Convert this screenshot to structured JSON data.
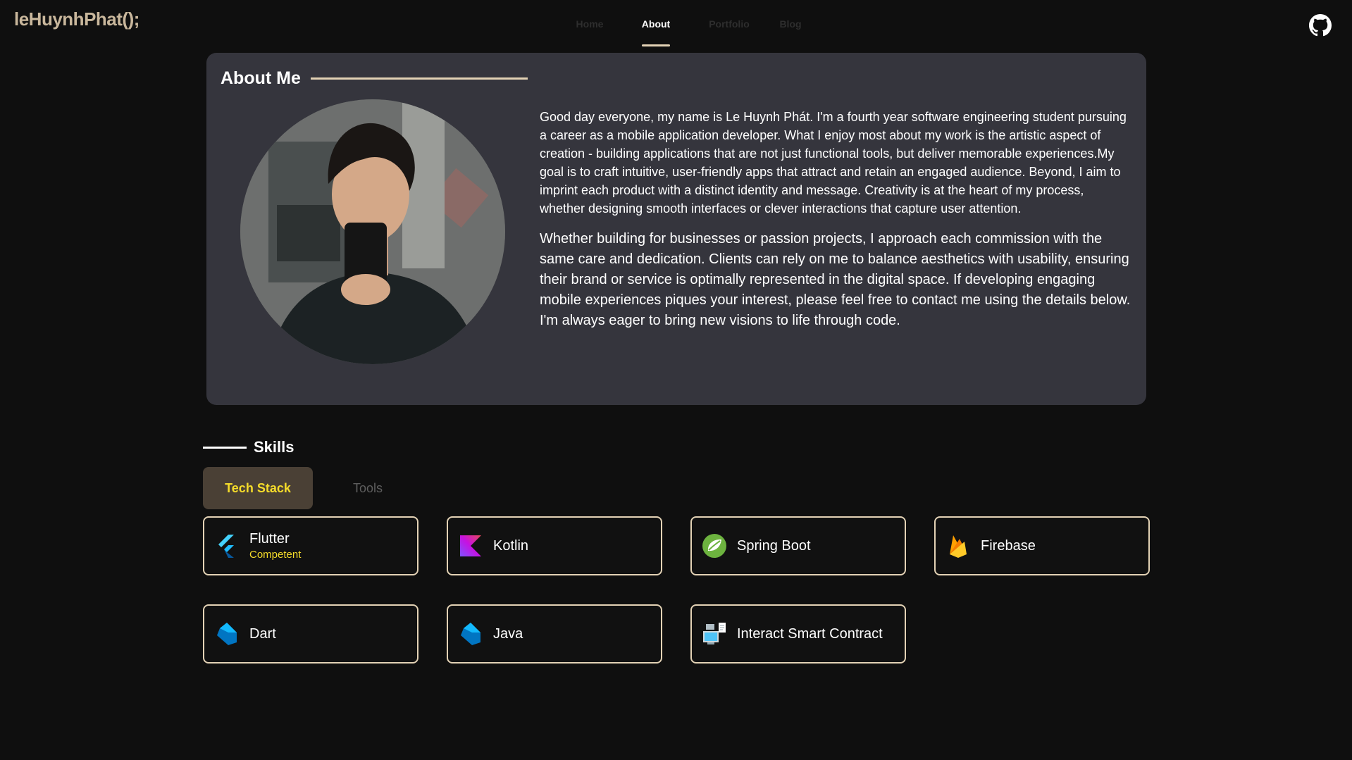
{
  "header": {
    "logo": "leHuynhPhat();",
    "nav": [
      "Home",
      "About",
      "Portfolio",
      "Blog"
    ],
    "active_nav": "About",
    "github_icon": "github-icon"
  },
  "about": {
    "title": "About Me",
    "paragraph1": "Good day everyone, my name is Le Huynh Phát. I'm a fourth year software engineering student pursuing a career as a mobile application developer. What I enjoy most about my work is the artistic aspect of creation - building applications that are not just functional tools, but deliver memorable experiences.My goal is to craft intuitive, user-friendly apps that attract and retain an engaged audience. Beyond, I aim to imprint each product with a distinct identity and message. Creativity is at the heart of my process, whether designing smooth interfaces or clever interactions that capture user attention.",
    "paragraph2": "Whether building for businesses or passion projects, I approach each commission with the same care and dedication. Clients can rely on me to balance aesthetics with usability, ensuring their brand or service is optimally represented in the digital space. If developing engaging mobile experiences piques your interest, please feel free to contact me using the details below. I'm always eager to bring new visions to life through code."
  },
  "skills": {
    "title": "Skills",
    "tabs": [
      "Tech Stack",
      "Tools"
    ],
    "active_tab": "Tech Stack",
    "items": [
      {
        "name": "Flutter",
        "level": "Competent",
        "icon": "flutter-icon"
      },
      {
        "name": "Kotlin",
        "icon": "kotlin-icon"
      },
      {
        "name": "Spring Boot",
        "icon": "spring-icon"
      },
      {
        "name": "Firebase",
        "icon": "firebase-icon"
      },
      {
        "name": "Dart",
        "icon": "dart-icon"
      },
      {
        "name": "Java",
        "icon": "java-icon"
      },
      {
        "name": "Interact Smart Contract",
        "icon": "smart-contract-icon"
      }
    ]
  },
  "colors": {
    "background": "#0f0f0f",
    "card": "#35353d",
    "accent": "#e3d2b5",
    "logo": "#c9b79c",
    "highlight": "#f5dc2a"
  }
}
